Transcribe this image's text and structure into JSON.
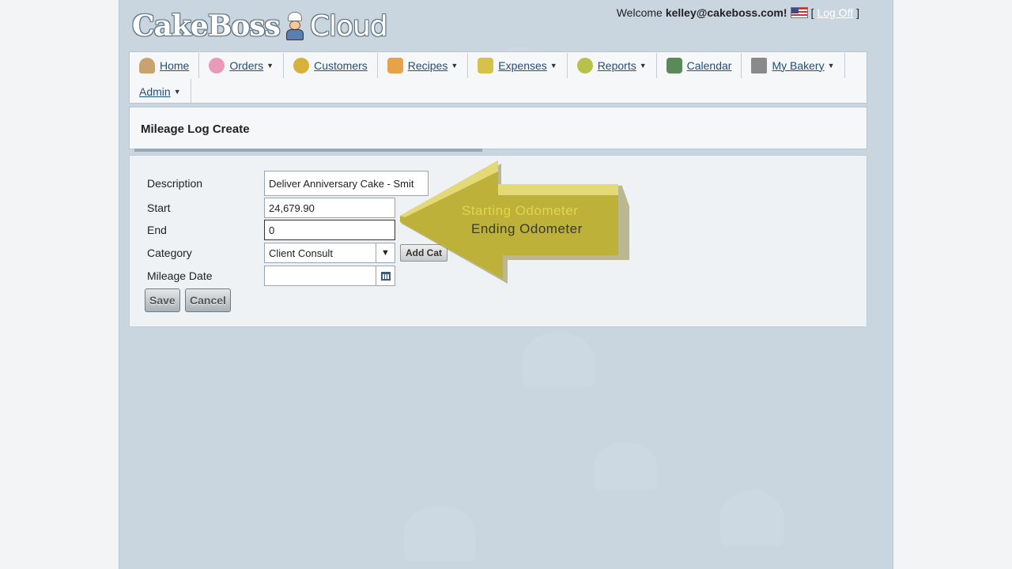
{
  "header": {
    "logo_main": "CakeBoss",
    "logo_cloud": "Cloud",
    "welcome_prefix": "Welcome",
    "user_email": "kelley@cakeboss.com!",
    "bracket_open": "[",
    "logout_label": "Log Off",
    "bracket_close": "]"
  },
  "nav": {
    "items": [
      {
        "label": "Home",
        "icon": "chef-icon",
        "color": "#7a5b40"
      },
      {
        "label": "Orders",
        "icon": "cake-icon",
        "color": "#e89ab8",
        "dropdown": "▼"
      },
      {
        "label": "Customers",
        "icon": "people-icon",
        "color": "#d8b13a"
      },
      {
        "label": "Recipes",
        "icon": "recipe-book-icon",
        "color": "#e8a24a",
        "dropdown": "▼"
      },
      {
        "label": "Expenses",
        "icon": "cash-register-icon",
        "color": "#d6c24a",
        "dropdown": "▼"
      },
      {
        "label": "Reports",
        "icon": "chart-icon",
        "color": "#b8c24a",
        "dropdown": "▼"
      },
      {
        "label": "Calendar",
        "icon": "calendar-icon",
        "color": "#5a8a5a"
      },
      {
        "label": "My Bakery",
        "icon": "tools-icon",
        "color": "#777777",
        "dropdown": "▼"
      },
      {
        "label": "Admin",
        "dropdown": "▼"
      }
    ]
  },
  "page": {
    "title": "Mileage Log Create"
  },
  "form": {
    "description_label": "Description",
    "description_value": "Deliver Anniversary Cake - Smit",
    "start_label": "Start",
    "start_value": "24,679.90",
    "end_label": "End",
    "end_value": "0",
    "category_label": "Category",
    "category_value": "Client Consult",
    "add_category_label": "Add Cat",
    "mileage_date_label": "Mileage Date",
    "mileage_date_value": "",
    "save_label": "Save",
    "cancel_label": "Cancel"
  },
  "callout": {
    "line1": "Starting Odometer",
    "line2": "Ending Odometer",
    "color": "#c8b927"
  }
}
